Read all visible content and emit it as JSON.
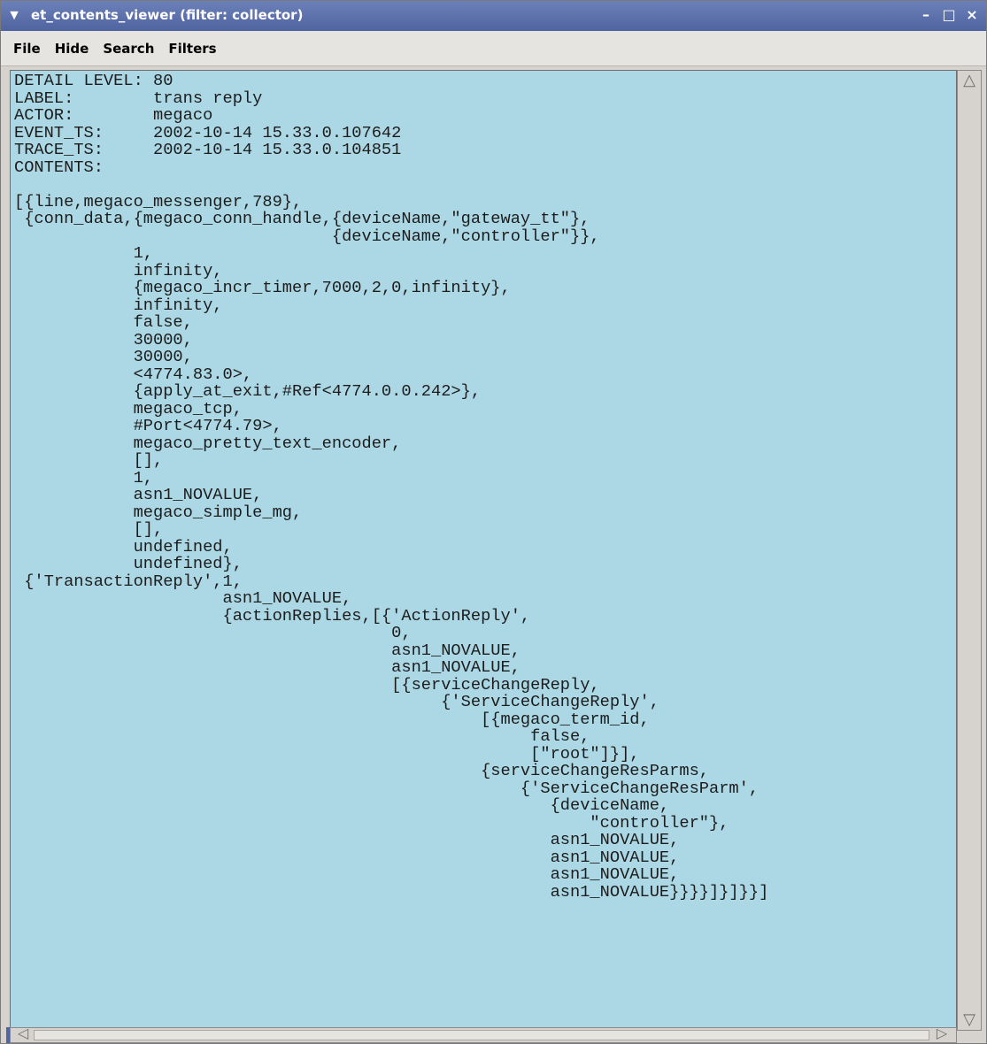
{
  "window": {
    "title": "et_contents_viewer (filter: collector)",
    "system_menu_icon": "chevron-down-icon",
    "controls": {
      "minimize": "minimize-icon",
      "maximize": "maximize-icon",
      "close": "close-icon"
    }
  },
  "menubar": {
    "file": "File",
    "hide": "Hide",
    "search": "Search",
    "filters": "Filters"
  },
  "event": {
    "lines": [
      "DETAIL LEVEL: 80",
      "LABEL:        trans reply",
      "ACTOR:        megaco",
      "EVENT_TS:     2002-10-14 15.33.0.107642",
      "TRACE_TS:     2002-10-14 15.33.0.104851",
      "CONTENTS:",
      "",
      "[{line,megaco_messenger,789},",
      " {conn_data,{megaco_conn_handle,{deviceName,\"gateway_tt\"},",
      "                                {deviceName,\"controller\"}},",
      "            1,",
      "            infinity,",
      "            {megaco_incr_timer,7000,2,0,infinity},",
      "            infinity,",
      "            false,",
      "            30000,",
      "            30000,",
      "            <4774.83.0>,",
      "            {apply_at_exit,#Ref<4774.0.0.242>},",
      "            megaco_tcp,",
      "            #Port<4774.79>,",
      "            megaco_pretty_text_encoder,",
      "            [],",
      "            1,",
      "            asn1_NOVALUE,",
      "            megaco_simple_mg,",
      "            [],",
      "            undefined,",
      "            undefined},",
      " {'TransactionReply',1,",
      "                     asn1_NOVALUE,",
      "                     {actionReplies,[{'ActionReply',",
      "                                      0,",
      "                                      asn1_NOVALUE,",
      "                                      asn1_NOVALUE,",
      "                                      [{serviceChangeReply,",
      "                                           {'ServiceChangeReply',",
      "                                               [{megaco_term_id,",
      "                                                    false,",
      "                                                    [\"root\"]}],",
      "                                               {serviceChangeResParms,",
      "                                                   {'ServiceChangeResParm',",
      "                                                      {deviceName,",
      "                                                          \"controller\"},",
      "                                                      asn1_NOVALUE,",
      "                                                      asn1_NOVALUE,",
      "                                                      asn1_NOVALUE,",
      "                                                      asn1_NOVALUE}}}}]}]}}]"
    ]
  },
  "scrollbars": {
    "up": "scroll-up-icon",
    "down": "scroll-down-icon",
    "left": "scroll-left-icon",
    "right": "scroll-right-icon"
  }
}
